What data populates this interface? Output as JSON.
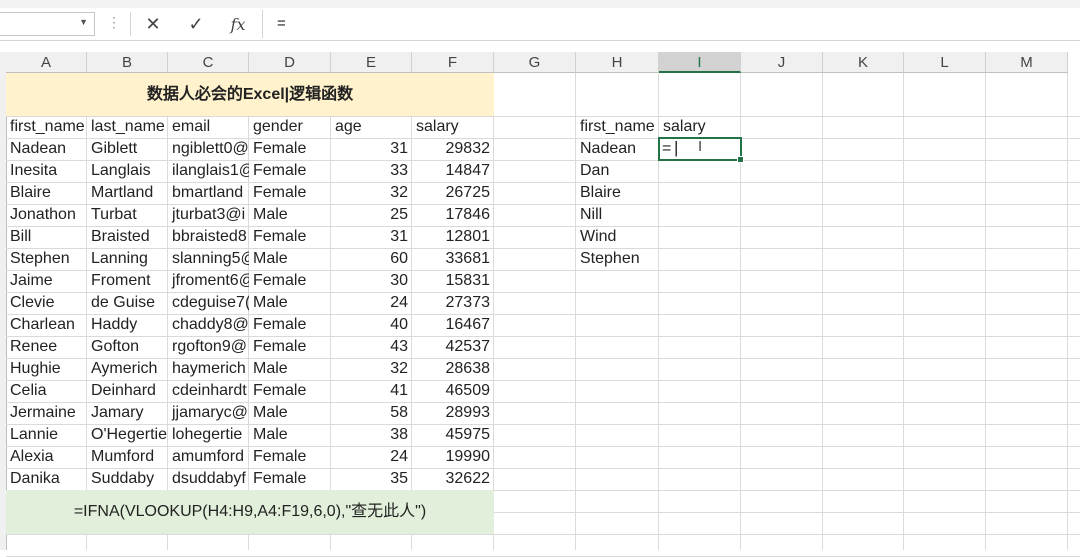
{
  "formula_bar": {
    "name_box": "",
    "cancel_icon": "cancel-icon",
    "enter_icon": "checkmark-icon",
    "function_icon": "function-icon",
    "function_label": "fx",
    "cancel_label": "✕",
    "enter_label": "✓",
    "content": "="
  },
  "columns": [
    "A",
    "B",
    "C",
    "D",
    "E",
    "F",
    "G",
    "H",
    "I",
    "J",
    "K",
    "L",
    "M"
  ],
  "selected_column": "I",
  "banner": "数据人必会的Excel|逻辑函数",
  "headers": [
    "first_name",
    "last_name",
    "email",
    "gender",
    "age",
    "salary"
  ],
  "rows": [
    {
      "first_name": "Nadean",
      "last_name": "Giblett",
      "email": "ngiblett0@",
      "gender": "Female",
      "age": "31",
      "salary": "29832"
    },
    {
      "first_name": "Inesita",
      "last_name": "Langlais",
      "email": "ilanglais1@",
      "gender": "Female",
      "age": "33",
      "salary": "14847"
    },
    {
      "first_name": "Blaire",
      "last_name": "Martland",
      "email": "bmartland",
      "gender": "Female",
      "age": "32",
      "salary": "26725"
    },
    {
      "first_name": "Jonathon",
      "last_name": "Turbat",
      "email": "jturbat3@i",
      "gender": "Male",
      "age": "25",
      "salary": "17846"
    },
    {
      "first_name": "Bill",
      "last_name": "Braisted",
      "email": "bbraisted8",
      "gender": "Female",
      "age": "31",
      "salary": "12801"
    },
    {
      "first_name": "Stephen",
      "last_name": "Lanning",
      "email": "slanning5@",
      "gender": "Male",
      "age": "60",
      "salary": "33681"
    },
    {
      "first_name": "Jaime",
      "last_name": "Froment",
      "email": "jfroment6@",
      "gender": "Female",
      "age": "30",
      "salary": "15831"
    },
    {
      "first_name": "Clevie",
      "last_name": "de Guise",
      "email": "cdeguise7(",
      "gender": "Male",
      "age": "24",
      "salary": "27373"
    },
    {
      "first_name": "Charlean",
      "last_name": "Haddy",
      "email": "chaddy8@",
      "gender": "Female",
      "age": "40",
      "salary": "16467"
    },
    {
      "first_name": "Renee",
      "last_name": "Gofton",
      "email": "rgofton9@",
      "gender": "Female",
      "age": "43",
      "salary": "42537"
    },
    {
      "first_name": "Hughie",
      "last_name": "Aymerich",
      "email": "haymerich",
      "gender": "Male",
      "age": "32",
      "salary": "28638"
    },
    {
      "first_name": "Celia",
      "last_name": "Deinhard",
      "email": "cdeinhardt",
      "gender": "Female",
      "age": "41",
      "salary": "46509"
    },
    {
      "first_name": "Jermaine",
      "last_name": "Jamary",
      "email": "jjamaryc@",
      "gender": "Male",
      "age": "58",
      "salary": "28993"
    },
    {
      "first_name": "Lannie",
      "last_name": "O'Hegertie",
      "email": "lohegertie",
      "gender": "Male",
      "age": "38",
      "salary": "45975"
    },
    {
      "first_name": "Alexia",
      "last_name": "Mumford",
      "email": "amumford",
      "gender": "Female",
      "age": "24",
      "salary": "19990"
    },
    {
      "first_name": "Danika",
      "last_name": "Suddaby",
      "email": "dsuddabyf",
      "gender": "Female",
      "age": "35",
      "salary": "32622"
    }
  ],
  "lookup": {
    "headers": [
      "first_name",
      "salary"
    ],
    "names": [
      "Nadean",
      "Dan",
      "Blaire",
      "Nill",
      "Wind",
      "Stephen"
    ],
    "active_value": "="
  },
  "formula_note": "=IFNA(VLOOKUP(H4:H9,A4:F19,6,0),\"查无此人\")"
}
